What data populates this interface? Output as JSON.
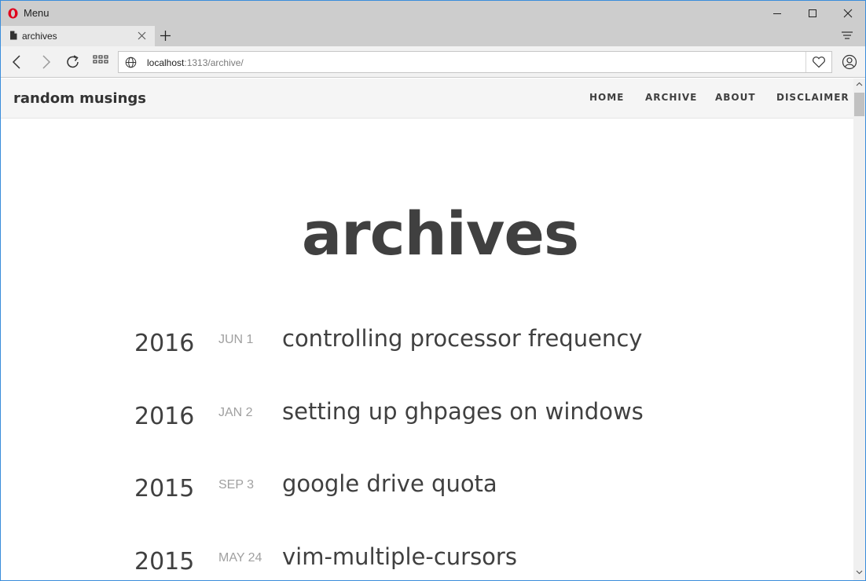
{
  "browser": {
    "menu_label": "Menu",
    "tab_title": "archives",
    "url_host": "localhost",
    "url_path": ":1313/archive/"
  },
  "site": {
    "brand": "random musings",
    "nav": [
      "HOME",
      "ARCHIVE",
      "ABOUT",
      "DISCLAIMER"
    ],
    "heading": "archives"
  },
  "posts": [
    {
      "year": "2016",
      "date": "JUN 1",
      "title": "controlling processor frequency"
    },
    {
      "year": "2016",
      "date": "JAN 2",
      "title": "setting up ghpages on windows"
    },
    {
      "year": "2015",
      "date": "SEP 3",
      "title": "google drive quota"
    },
    {
      "year": "2015",
      "date": "MAY 24",
      "title": "vim-multiple-cursors"
    }
  ],
  "colors": {
    "opera_red": "#e0001b",
    "window_border": "#3a8ddb",
    "text_dark": "#404040",
    "date_gray": "#a0a0a0"
  }
}
